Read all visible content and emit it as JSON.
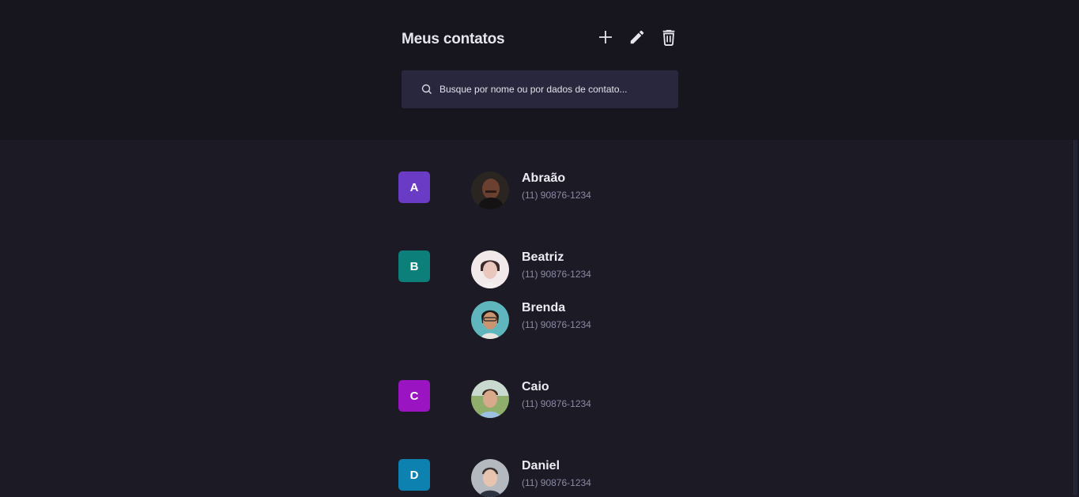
{
  "header": {
    "title": "Meus contatos",
    "actions": {
      "add_icon": "plus-icon",
      "edit_icon": "pencil-icon",
      "delete_icon": "trash-icon"
    }
  },
  "search": {
    "placeholder": "Busque por nome ou por dados de contato...",
    "icon": "search-icon"
  },
  "colors": {
    "A": "#6a3bc4",
    "B": "#0d7f7a",
    "C": "#9a14c2",
    "D": "#0d82b0"
  },
  "groups": [
    {
      "letter": "A",
      "contacts": [
        {
          "name": "Abraão",
          "phone": "(11) 90876-1234"
        }
      ]
    },
    {
      "letter": "B",
      "contacts": [
        {
          "name": "Beatriz",
          "phone": "(11) 90876-1234"
        },
        {
          "name": "Brenda",
          "phone": "(11) 90876-1234"
        }
      ]
    },
    {
      "letter": "C",
      "contacts": [
        {
          "name": "Caio",
          "phone": "(11) 90876-1234"
        }
      ]
    },
    {
      "letter": "D",
      "contacts": [
        {
          "name": "Daniel",
          "phone": "(11) 90876-1234"
        }
      ]
    }
  ]
}
